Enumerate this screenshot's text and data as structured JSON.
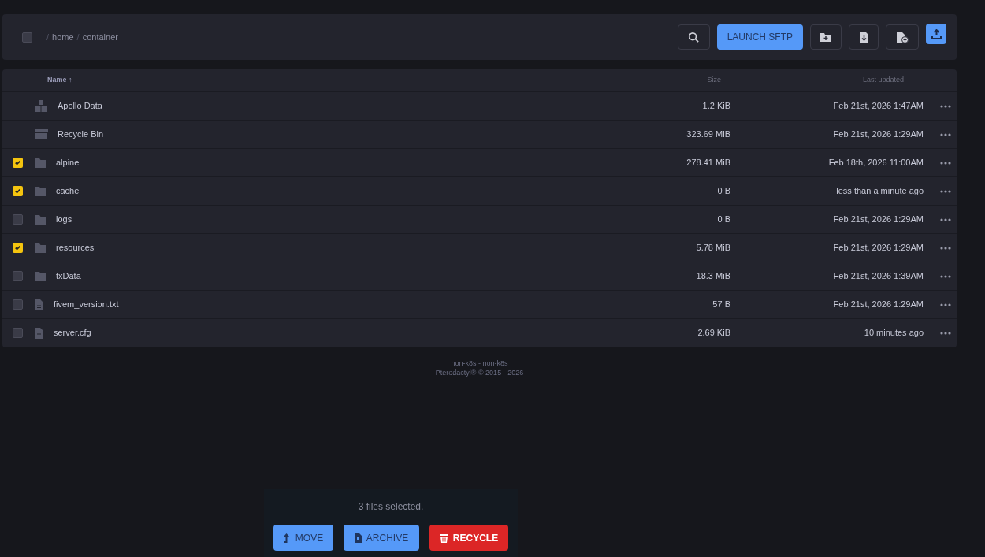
{
  "toolbar": {
    "select_all": {
      "checked": false
    },
    "breadcrumb": [
      {
        "separator": "/",
        "label": "home"
      },
      {
        "separator": "/",
        "label": "container"
      }
    ],
    "buttons": [
      {
        "kind": "search"
      },
      {
        "kind": "primary",
        "label": "LAUNCH SFTP"
      },
      {
        "kind": "new-folder"
      },
      {
        "kind": "pull-file"
      },
      {
        "kind": "new-file"
      },
      {
        "kind": "upload"
      }
    ]
  },
  "table": {
    "columns": [
      "Name ↑",
      "Size",
      "Last updated"
    ],
    "rows": [
      {
        "kind": "box",
        "name": "Apollo Data",
        "size": "1.2 KiB",
        "updated": "Feb 21st, 2026 1:47AM"
      },
      {
        "kind": "bin",
        "name": "Recycle Bin",
        "size": "323.69 MiB",
        "updated": "Feb 21st, 2026 1:29AM"
      },
      {
        "kind": "folder",
        "selected": true,
        "name": "alpine",
        "size": "278.41 MiB",
        "updated": "Feb 18th, 2026 11:00AM"
      },
      {
        "kind": "folder",
        "selected": true,
        "name": "cache",
        "size": "0 B",
        "updated": "less than a minute ago"
      },
      {
        "kind": "folder",
        "selected": false,
        "name": "logs",
        "size": "0 B",
        "updated": "Feb 21st, 2026 1:29AM"
      },
      {
        "kind": "folder",
        "selected": true,
        "name": "resources",
        "size": "5.78 MiB",
        "updated": "Feb 21st, 2026 1:29AM"
      },
      {
        "kind": "folder",
        "selected": false,
        "name": "txData",
        "size": "18.3 MiB",
        "updated": "Feb 21st, 2026 1:39AM"
      },
      {
        "kind": "file",
        "selected": false,
        "name": "fivem_version.txt",
        "size": "57 B",
        "updated": "Feb 21st, 2026 1:29AM"
      },
      {
        "kind": "file",
        "selected": false,
        "name": "server.cfg",
        "size": "2.69 KiB",
        "updated": "10 minutes ago"
      }
    ]
  },
  "footer": [
    "non-k8s - non-k8s",
    "Pterodactyl® © 2015 - 2026"
  ],
  "selection_bar": {
    "message": "3 files selected.",
    "buttons": [
      {
        "kind": "move",
        "label": "MOVE"
      },
      {
        "kind": "archive",
        "label": "ARCHIVE"
      },
      {
        "kind": "recycle",
        "label": "RECYCLE"
      }
    ]
  }
}
